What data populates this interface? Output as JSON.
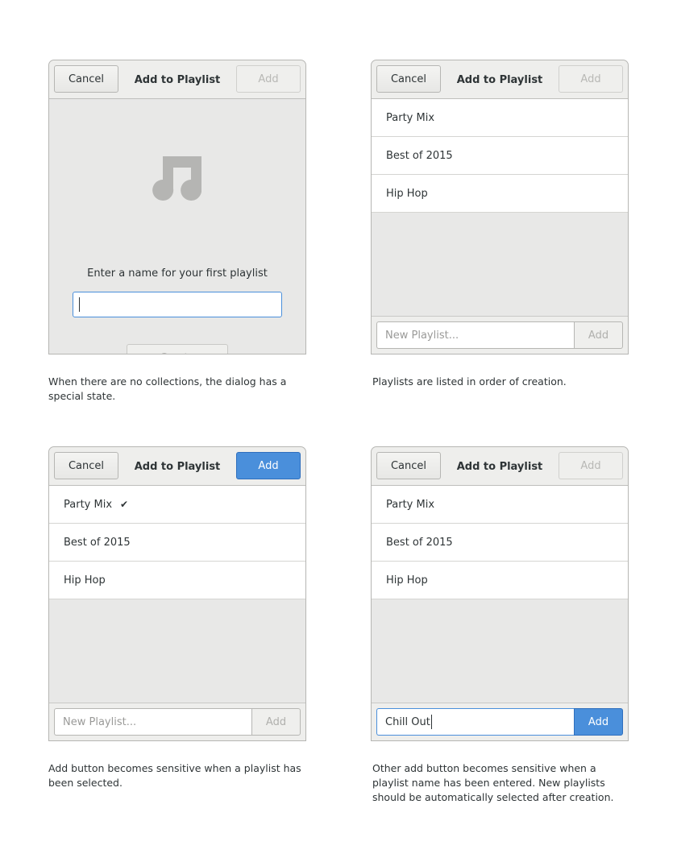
{
  "dialogs": [
    {
      "cancel_label": "Cancel",
      "title": "Add to Playlist",
      "add_label": "Add",
      "empty_state": {
        "icon": "music-note-icon",
        "label": "Enter a name for your first playlist",
        "entry_value": "",
        "create_label": "Create"
      },
      "caption": "When there are no collections, the dialog has a special state."
    },
    {
      "cancel_label": "Cancel",
      "title": "Add to Playlist",
      "add_label": "Add",
      "playlists": [
        "Party Mix",
        "Best of 2015",
        "Hip Hop"
      ],
      "new_playlist_placeholder": "New Playlist...",
      "footer_add_label": "Add",
      "caption": "Playlists are listed in order of creation."
    },
    {
      "cancel_label": "Cancel",
      "title": "Add to Playlist",
      "add_label": "Add",
      "playlists": [
        "Party Mix",
        "Best of 2015",
        "Hip Hop"
      ],
      "selected": "Party Mix",
      "check_icon": "checkmark-icon",
      "new_playlist_placeholder": "New Playlist...",
      "footer_add_label": "Add",
      "caption": "Add button becomes sensitive when a playlist has been selected."
    },
    {
      "cancel_label": "Cancel",
      "title": "Add to Playlist",
      "add_label": "Add",
      "playlists": [
        "Party Mix",
        "Best of 2015",
        "Hip Hop"
      ],
      "new_playlist_value": "Chill Out",
      "footer_add_label": "Add",
      "caption": "Other add button becomes sensitive when a playlist name has been entered. New playlists should be automatically selected after creation."
    }
  ],
  "colors": {
    "accent": "#4a8fdb",
    "headerbar": "#eeeeec",
    "body_bg": "#e8e8e7",
    "disabled_text": "#b8b8b5"
  }
}
